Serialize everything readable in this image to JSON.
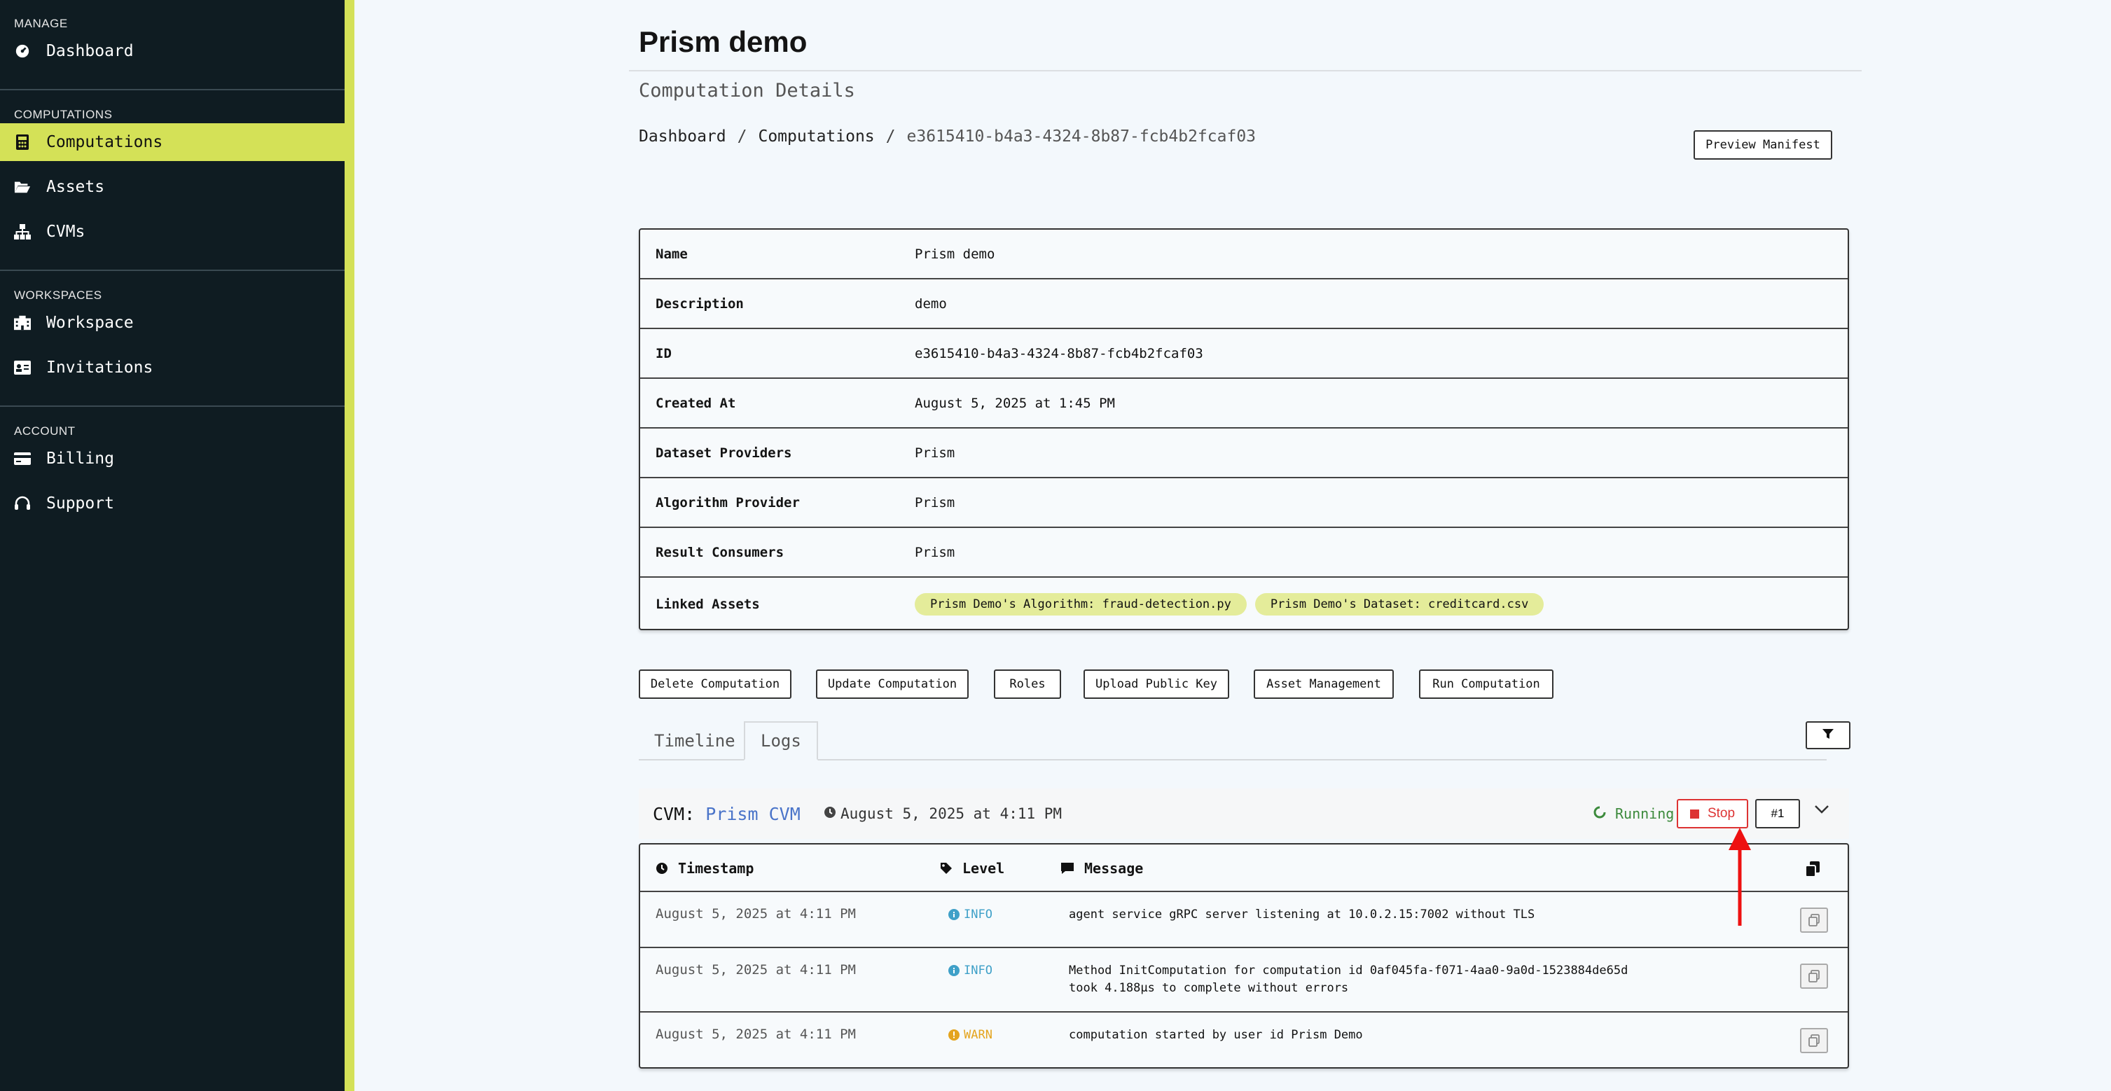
{
  "sidebar": {
    "sections": [
      {
        "title": "MANAGE",
        "items": [
          {
            "label": "Dashboard",
            "icon": "gauge-icon"
          }
        ]
      },
      {
        "title": "COMPUTATIONS",
        "items": [
          {
            "label": "Computations",
            "icon": "calculator-icon",
            "active": true
          },
          {
            "label": "Assets",
            "icon": "folder-open-icon"
          },
          {
            "label": "CVMs",
            "icon": "sitemap-icon"
          }
        ]
      },
      {
        "title": "WORKSPACES",
        "items": [
          {
            "label": "Workspace",
            "icon": "building-icon"
          },
          {
            "label": "Invitations",
            "icon": "id-card-icon"
          }
        ]
      },
      {
        "title": "ACCOUNT",
        "items": [
          {
            "label": "Billing",
            "icon": "credit-card-icon"
          },
          {
            "label": "Support",
            "icon": "headset-icon"
          }
        ]
      }
    ]
  },
  "header": {
    "title": "Prism demo",
    "subtitle": "Computation Details",
    "breadcrumb": [
      "Dashboard",
      "Computations",
      "e3615410-b4a3-4324-8b87-fcb4b2fcaf03"
    ],
    "preview_manifest": "Preview Manifest"
  },
  "details": [
    {
      "label": "Name",
      "value": "Prism demo"
    },
    {
      "label": "Description",
      "value": "demo"
    },
    {
      "label": "ID",
      "value": "e3615410-b4a3-4324-8b87-fcb4b2fcaf03"
    },
    {
      "label": "Created At",
      "value": "August 5, 2025 at 1:45 PM"
    },
    {
      "label": "Dataset Providers",
      "value": "Prism"
    },
    {
      "label": "Algorithm Provider",
      "value": "Prism"
    },
    {
      "label": "Result Consumers",
      "value": "Prism"
    },
    {
      "label": "Linked Assets",
      "chips": [
        "Prism Demo's Algorithm: fraud-detection.py",
        "Prism Demo's Dataset: creditcard.csv"
      ]
    }
  ],
  "actions": [
    "Delete Computation",
    "Update Computation",
    "Roles",
    "Upload Public Key",
    "Asset Management",
    "Run Computation"
  ],
  "tabs": [
    "Timeline",
    "Logs"
  ],
  "active_tab": "Logs",
  "cvm": {
    "label": "CVM:",
    "name": "Prism CVM",
    "time": "August 5, 2025 at 4:11 PM",
    "status": "Running",
    "stop": "Stop",
    "number": "#1"
  },
  "logs": {
    "headers": {
      "timestamp": "Timestamp",
      "level": "Level",
      "message": "Message"
    },
    "rows": [
      {
        "timestamp": "August 5, 2025 at 4:11 PM",
        "level": "INFO",
        "message": "agent service gRPC server listening at 10.0.2.15:7002 without TLS"
      },
      {
        "timestamp": "August 5, 2025 at 4:11 PM",
        "level": "INFO",
        "message": "Method InitComputation for computation id 0af045fa-f071-4aa0-9a0d-1523884de65d",
        "message2": "took 4.188µs to complete without errors"
      },
      {
        "timestamp": "August 5, 2025 at 4:11 PM",
        "level": "WARN",
        "message": "computation started by user id Prism Demo"
      }
    ]
  },
  "colors": {
    "accent": "#d4e157",
    "sidebar_bg": "#0f1c22",
    "stop": "#dd3333",
    "running": "#3c8a3c",
    "info": "#3fa0c8",
    "warn": "#e4a41e",
    "annotation_arrow": "#ee1111"
  }
}
